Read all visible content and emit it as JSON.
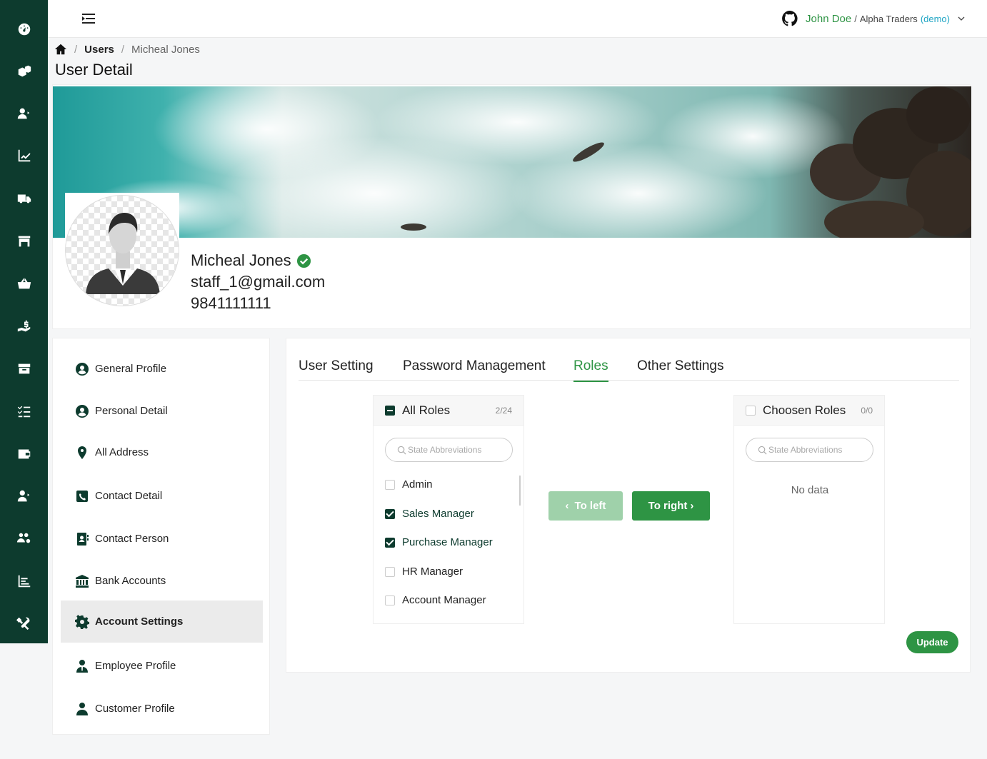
{
  "rail": {
    "icons": [
      "dashboard-icon",
      "inventory-icon",
      "user-add-icon",
      "chart-icon",
      "truck-icon",
      "store-icon",
      "basket-icon",
      "payment-icon",
      "box-icon",
      "checklist-icon",
      "wallet-icon",
      "user-manage-icon",
      "users-settings-icon",
      "report-icon",
      "tools-icon"
    ]
  },
  "header": {
    "user_name": "John Doe",
    "separator": "/",
    "org": "Alpha Traders",
    "env": "(demo)"
  },
  "breadcrumb": {
    "sep": "/",
    "users": "Users",
    "current": "Micheal Jones"
  },
  "page_title": "User Detail",
  "profile": {
    "name": "Micheal Jones",
    "email": "staff_1@gmail.com",
    "phone": "9841111111",
    "verified_color": "#2e9444"
  },
  "side_menu": {
    "items": [
      {
        "label": "General Profile",
        "icon": "user-circle-icon"
      },
      {
        "label": "Personal Detail",
        "icon": "user-circle-icon"
      },
      {
        "label": "All Address",
        "icon": "location-pin-icon"
      },
      {
        "label": "Contact Detail",
        "icon": "phone-icon"
      },
      {
        "label": "Contact Person",
        "icon": "contact-book-icon"
      },
      {
        "label": "Bank Accounts",
        "icon": "bank-icon"
      },
      {
        "label": "Account Settings",
        "icon": "gear-icon",
        "active": true
      },
      {
        "label": "Employee Profile",
        "icon": "employee-icon"
      },
      {
        "label": "Customer Profile",
        "icon": "person-icon"
      }
    ]
  },
  "tabs": {
    "user_setting": "User Setting",
    "password": "Password Management",
    "roles": "Roles",
    "other": "Other Settings"
  },
  "transfer": {
    "left": {
      "title": "All Roles",
      "count": "2/24",
      "search_placeholder": "State Abbreviations",
      "items": [
        {
          "label": "Admin",
          "checked": false
        },
        {
          "label": "Sales Manager",
          "checked": true
        },
        {
          "label": "Purchase Manager",
          "checked": true
        },
        {
          "label": "HR Manager",
          "checked": false
        },
        {
          "label": "Account Manager",
          "checked": false
        }
      ]
    },
    "right": {
      "title": "Choosen Roles",
      "count": "0/0",
      "search_placeholder": "State Abbreviations",
      "empty": "No data"
    },
    "to_left": "To left",
    "to_right": "To right"
  },
  "update_label": "Update",
  "colors": {
    "rail": "#0d3b2e",
    "accent": "#2e9444",
    "accent_disabled": "#9fd1aa"
  }
}
